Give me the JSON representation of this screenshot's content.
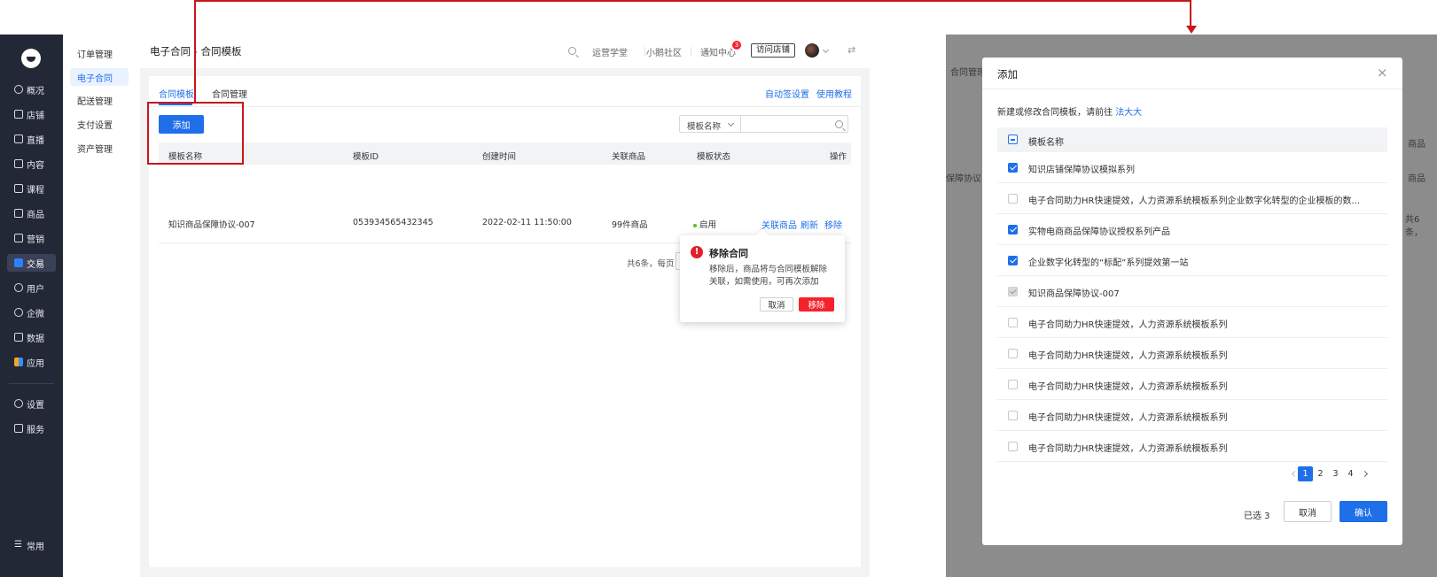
{
  "rail": {
    "items": [
      {
        "label": "概况",
        "icon": "clock-icon"
      },
      {
        "label": "店铺",
        "icon": "store-icon"
      },
      {
        "label": "直播",
        "icon": "live-icon"
      },
      {
        "label": "内容",
        "icon": "document-icon"
      },
      {
        "label": "课程",
        "icon": "book-icon"
      },
      {
        "label": "商品",
        "icon": "box-icon"
      },
      {
        "label": "营销",
        "icon": "megaphone-icon"
      },
      {
        "label": "交易",
        "icon": "trade-icon",
        "active": true
      },
      {
        "label": "用户",
        "icon": "user-icon"
      },
      {
        "label": "企微",
        "icon": "chat-icon"
      },
      {
        "label": "数据",
        "icon": "chart-icon"
      },
      {
        "label": "应用",
        "icon": "apps-icon"
      }
    ],
    "settings_label": "设置",
    "service_label": "服务",
    "common_label": "常用"
  },
  "subnav": {
    "items": [
      "订单管理",
      "电子合同",
      "配送管理",
      "支付设置",
      "资产管理"
    ]
  },
  "topbar": {
    "breadcrumb": "电子合同 - 合同模板",
    "links": [
      "运营学堂",
      "小鹅社区",
      "通知中心"
    ],
    "notify_count": "3",
    "visit_store": "访问店铺",
    "swap_icon": "⇄"
  },
  "content": {
    "tabs": [
      "合同模板",
      "合同管理"
    ],
    "auto_sign": "自动签设置",
    "tutorial": "使用教程",
    "add_button": "添加",
    "filter_select": "模板名称",
    "columns": [
      "模板名称",
      "模板ID",
      "创建时间",
      "关联商品",
      "模板状态",
      "操作"
    ],
    "rows": [
      {
        "name": "知识商品保障协议-007",
        "id": "053934565432345",
        "created": "2022-02-11 11:50:00",
        "goods": "99件商品",
        "status": "启用",
        "actions": [
          "关联商品",
          "刷新",
          "移除"
        ]
      }
    ],
    "pager_text": "共6条，每页"
  },
  "popover": {
    "title": "移除合同",
    "body": "移除后，商品将与合同模板解除关联，如需使用，可再次添加",
    "cancel": "取消",
    "confirm": "移除"
  },
  "right_bg": {
    "tab": "合同管理",
    "header_goods": "商品",
    "row_name": "保障协议-",
    "row_goods": "商品",
    "pager": "共6条，"
  },
  "modal": {
    "title": "添加",
    "close": "×",
    "hint_prefix": "新建或修改合同模板，请前往",
    "hint_link": "法大大",
    "header": "模板名称",
    "rows": [
      {
        "label": "知识店铺保障协议模拟系列",
        "state": "checked"
      },
      {
        "label": "电子合同助力HR快速提效，人力资源系统模板系列企业数字化转型的企业模板的数...",
        "state": "unchecked"
      },
      {
        "label": "实物电商商品保障协议授权系列产品",
        "state": "checked"
      },
      {
        "label": "企业数字化转型的“标配”系列提效第一站",
        "state": "checked"
      },
      {
        "label": "知识商品保障协议-007",
        "state": "disabled"
      },
      {
        "label": "电子合同助力HR快速提效，人力资源系统模板系列",
        "state": "unchecked"
      },
      {
        "label": "电子合同助力HR快速提效，人力资源系统模板系列",
        "state": "unchecked"
      },
      {
        "label": "电子合同助力HR快速提效，人力资源系统模板系列",
        "state": "unchecked"
      },
      {
        "label": "电子合同助力HR快速提效，人力资源系统模板系列",
        "state": "unchecked"
      },
      {
        "label": "电子合同助力HR快速提效，人力资源系统模板系列",
        "state": "unchecked"
      }
    ],
    "pages": [
      "1",
      "2",
      "3",
      "4"
    ],
    "current_page": "1",
    "selected_text": "已选 3",
    "cancel": "取消",
    "confirm": "确认"
  },
  "colors": {
    "primary": "#1f6fe8",
    "danger": "#f5222d",
    "annotation": "#c8161d",
    "rail": "#232837"
  }
}
